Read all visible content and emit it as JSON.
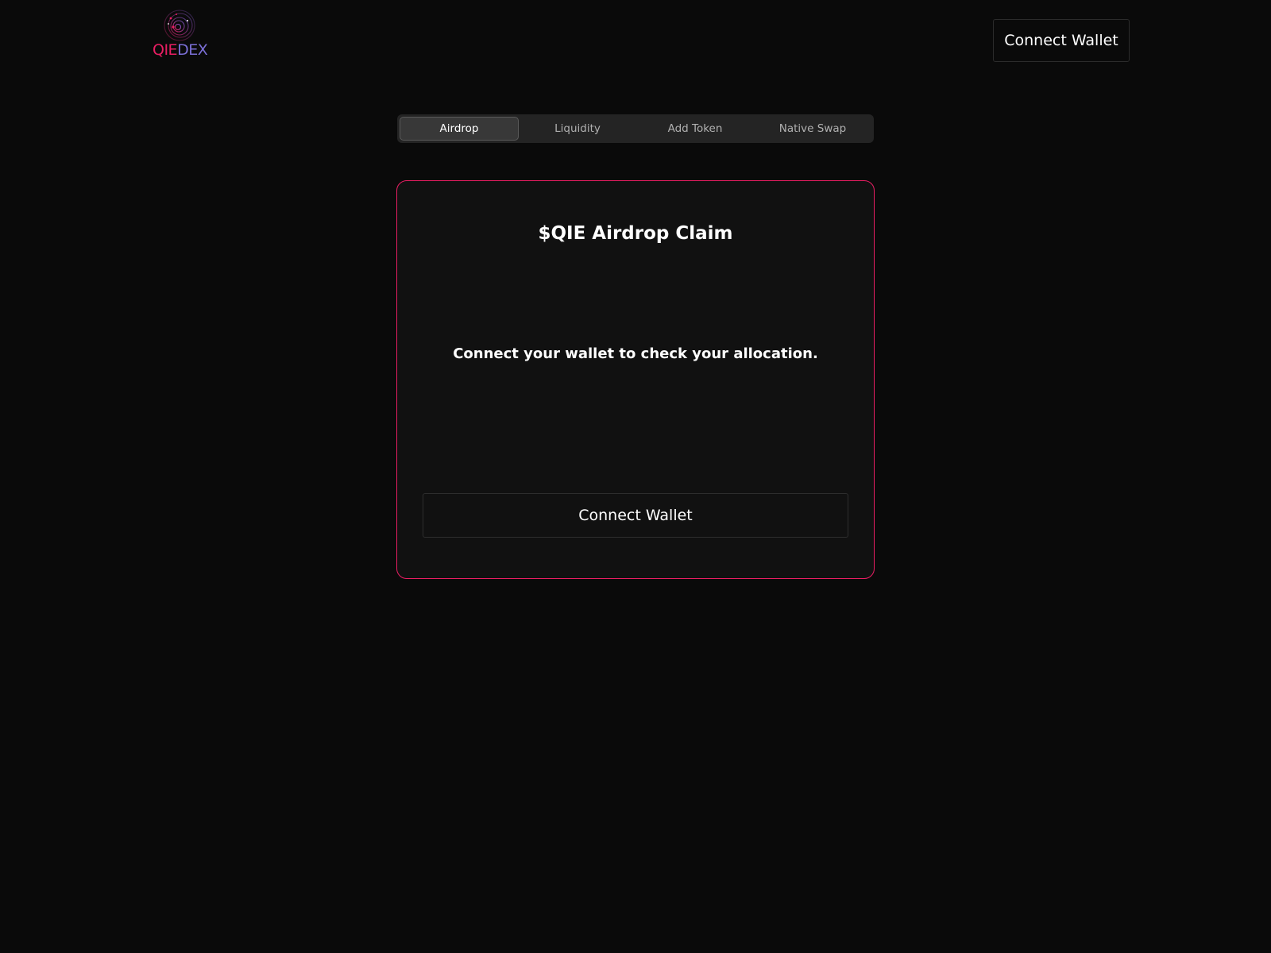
{
  "header": {
    "logo": {
      "icon": "spiral-galaxy-logo-icon",
      "text_part1": "QIE",
      "text_part2": "DEX",
      "colors": {
        "qie": "#e91e63",
        "dex": "#7b6fd6"
      }
    },
    "connect_wallet_label": "Connect Wallet"
  },
  "tabs": [
    {
      "label": "Airdrop",
      "active": true
    },
    {
      "label": "Liquidity",
      "active": false
    },
    {
      "label": "Add Token",
      "active": false
    },
    {
      "label": "Native Swap",
      "active": false
    }
  ],
  "card": {
    "title": "$QIE Airdrop Claim",
    "message": "Connect your wallet to check your allocation.",
    "connect_wallet_label": "Connect Wallet",
    "border_color": "#e91e63"
  },
  "colors": {
    "background": "#0a0a0a",
    "card_background": "#111111",
    "accent": "#e91e63"
  }
}
